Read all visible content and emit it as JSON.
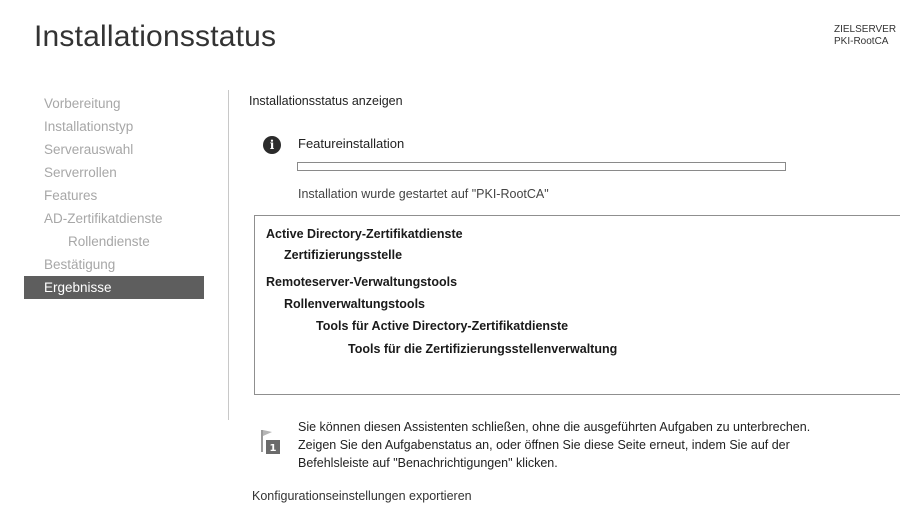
{
  "header": {
    "title": "Installationsstatus",
    "target_server_label": "ZIELSERVER",
    "target_server_name": "PKI-RootCA"
  },
  "sidebar": {
    "items": [
      {
        "label": "Vorbereitung",
        "state": "inactive"
      },
      {
        "label": "Installationstyp",
        "state": "inactive"
      },
      {
        "label": "Serverauswahl",
        "state": "inactive"
      },
      {
        "label": "Serverrollen",
        "state": "inactive"
      },
      {
        "label": "Features",
        "state": "inactive"
      },
      {
        "label": "AD-Zertifikatdienste",
        "state": "inactive"
      },
      {
        "label": "Rollendienste",
        "state": "inactive",
        "indented": true
      },
      {
        "label": "Bestätigung",
        "state": "inactive"
      },
      {
        "label": "Ergebnisse",
        "state": "active"
      }
    ]
  },
  "main": {
    "section_title": "Installationsstatus anzeigen",
    "feature_install": {
      "icon": "info-icon",
      "title": "Featureinstallation",
      "progress_fraction": 0,
      "message": "Installation wurde gestartet auf \"PKI-RootCA\""
    },
    "results": [
      {
        "label": "Active Directory-Zertifikatdienste",
        "level": 0
      },
      {
        "label": "Zertifizierungsstelle",
        "level": 1
      },
      {
        "label": "Remoteserver-Verwaltungstools",
        "level": 0
      },
      {
        "label": "Rollenverwaltungstools",
        "level": 1
      },
      {
        "label": "Tools für Active Directory-Zertifikatdienste",
        "level": 2
      },
      {
        "label": "Tools für die Zertifizierungsstellenverwaltung",
        "level": 3
      }
    ],
    "notice": {
      "icon": "notification-flag-icon",
      "badge": "1",
      "lines": [
        "Sie können diesen Assistenten schließen, ohne die ausgeführten Aufgaben zu unterbrechen.",
        "Zeigen Sie den Aufgabenstatus an, oder öffnen Sie diese Seite erneut, indem Sie auf der",
        "Befehlsleiste auf \"Benachrichtigungen\" klicken."
      ]
    },
    "export_link": "Konfigurationseinstellungen exportieren"
  },
  "colors": {
    "active_nav_bg": "#5e5e5e",
    "inactive_nav_text": "#a7a7a7",
    "progress_fill": "#4a9a3a"
  }
}
